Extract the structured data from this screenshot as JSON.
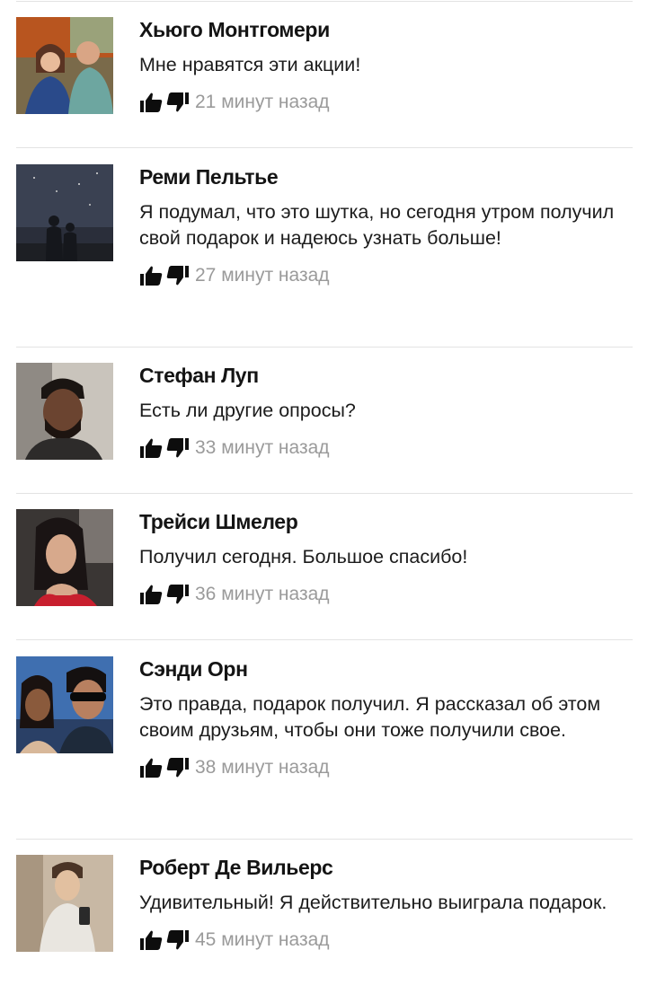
{
  "comments": [
    {
      "name": "Хьюго Монтгомери",
      "text": "Мне нравятся эти акции!",
      "time": "21 минут назад",
      "avatar": "couple-portrait-outdoor"
    },
    {
      "name": "Реми Пельтье",
      "text": "Я подумал, что это шутка, но сегодня утром получил свой подарок и надеюсь узнать больше!",
      "time": "27 минут назад",
      "avatar": "night-sky-couple"
    },
    {
      "name": "Стефан Луп",
      "text": "Есть ли другие опросы?",
      "time": "33 минут назад",
      "avatar": "man-in-car-selfie"
    },
    {
      "name": "Трейси Шмелер",
      "text": "Получил сегодня. Большое спасибо!",
      "time": "36 минут назад",
      "avatar": "woman-in-car-selfie"
    },
    {
      "name": "Сэнди Орн",
      "text": "Это правда, подарок получил. Я рассказал об этом своим друзьям, чтобы они тоже получили свое.",
      "time": "38 минут назад",
      "avatar": "couple-sunglasses-selfie"
    },
    {
      "name": "Роберт Де Вильерс",
      "text": "Удивительный! Я действительно выиграла подарок.",
      "time": "45 минут назад",
      "avatar": "mirror-selfie-young-man"
    }
  ],
  "icons": {
    "like": "thumbs-up-icon",
    "dislike": "thumbs-down-icon"
  },
  "colors": {
    "name": "#141414",
    "text": "#1c1c1c",
    "time": "#9a9a9a",
    "divider": "#e3e3e3",
    "icon": "#0d0d0d"
  }
}
